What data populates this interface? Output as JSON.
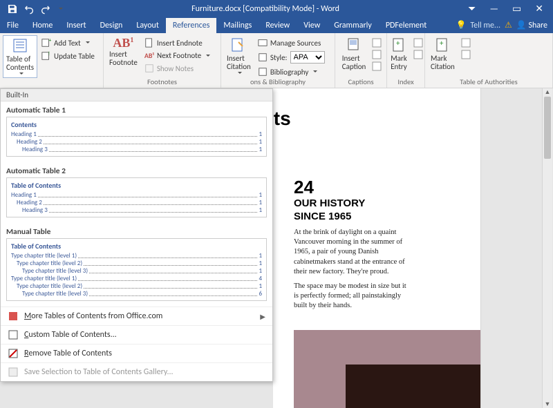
{
  "title": "Furniture.docx [Compatibility Mode] - Word",
  "tabs": [
    "File",
    "Home",
    "Insert",
    "Design",
    "Layout",
    "References",
    "Mailings",
    "Review",
    "View",
    "Grammarly",
    "PDFelement"
  ],
  "active_tab": "References",
  "tell_me": "Tell me...",
  "share": "Share",
  "ribbon": {
    "toc_btn": "Table of\nContents",
    "add_text": "Add Text",
    "update_table": "Update Table",
    "insert_footnote": "Insert\nFootnote",
    "insert_endnote": "Insert Endnote",
    "next_footnote": "Next Footnote",
    "show_notes": "Show Notes",
    "insert_citation": "Insert\nCitation",
    "manage_sources": "Manage Sources",
    "style_label": "Style:",
    "style_value": "APA",
    "bibliography": "Bibliography",
    "insert_caption": "Insert\nCaption",
    "mark_entry": "Mark\nEntry",
    "mark_citation": "Mark\nCitation",
    "groups": {
      "footnotes": "Footnotes",
      "citations": "ons & Bibliography",
      "captions": "Captions",
      "index": "Index",
      "toa": "Table of Authorities"
    }
  },
  "dropdown": {
    "builtin": "Built-In",
    "auto1": "Automatic Table 1",
    "auto1_title": "Contents",
    "auto2": "Automatic Table 2",
    "auto2_title": "Table of Contents",
    "manual": "Manual Table",
    "manual_title": "Table of Contents",
    "heading1": "Heading 1",
    "heading2": "Heading 2",
    "heading3": "Heading 3",
    "tc1": "Type chapter title (level 1)",
    "tc2": "Type chapter title (level 2)",
    "tc3": "Type chapter title (level 3)",
    "page1": "1",
    "page4": "4",
    "page6": "6",
    "more": "More Tables of Contents from Office.com",
    "custom": "Custom Table of Contents...",
    "remove": "Remove Table of Contents",
    "save_gallery": "Save Selection to Table of Contents Gallery..."
  },
  "document": {
    "title_fragment": "its",
    "number": "24",
    "heading": "OUR HISTORY SINCE 1965",
    "para1": "At the brink of daylight on a quaint Vancouver morning in the summer of 1965, a pair of young Danish cabinetmakers stand at the entrance of their new factory. They're proud.",
    "para2": "The space may be modest in size but it is perfectly formed; all painstakingly built by their hands."
  }
}
